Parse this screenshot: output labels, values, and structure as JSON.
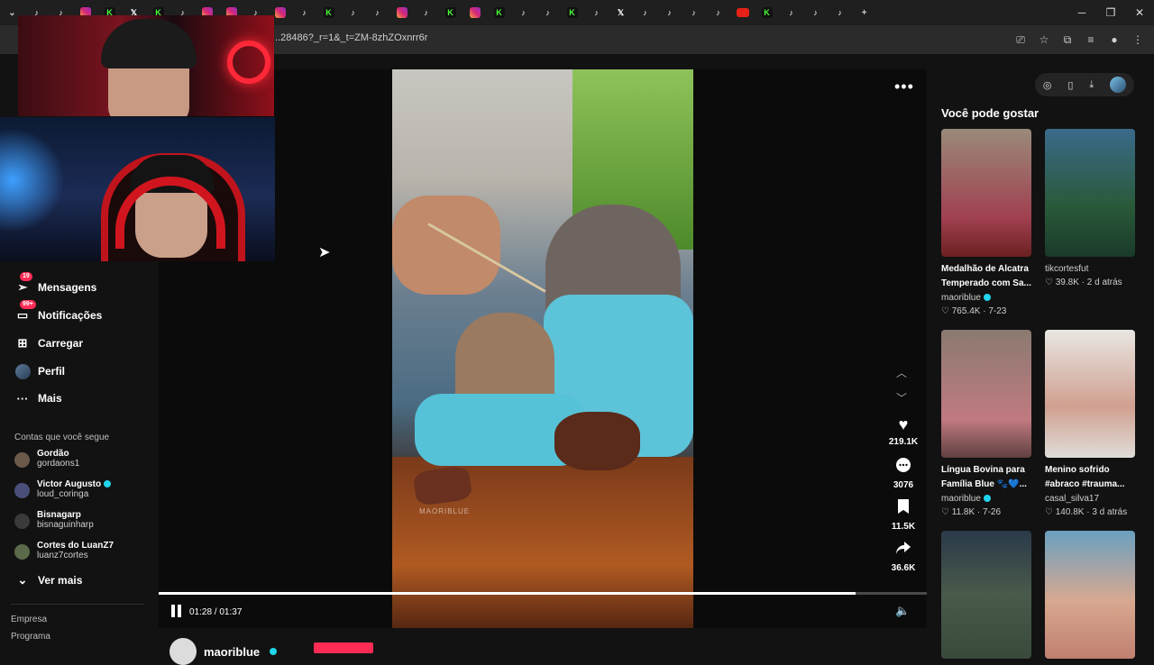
{
  "browser": {
    "url": "...28486?_r=1&_t=ZM-8zhZOxnrr6r",
    "tabs": [
      "tt",
      "tt",
      "ig",
      "k",
      "x",
      "k",
      "tt",
      "ig",
      "ig",
      "tt",
      "ig",
      "tt",
      "k",
      "tt",
      "tt",
      "ig",
      "tt",
      "k",
      "ig",
      "k",
      "tt",
      "tt",
      "k",
      "tt",
      "x",
      "tt",
      "tt",
      "tt",
      "tt",
      "yt",
      "k",
      "tt",
      "tt",
      "tt"
    ]
  },
  "sidebar": {
    "items": [
      {
        "label": "Mensagens",
        "icon": "send-icon",
        "badge": "19"
      },
      {
        "label": "Notificações",
        "icon": "inbox-icon",
        "badge": "99+"
      },
      {
        "label": "Carregar",
        "icon": "plus-square-icon"
      },
      {
        "label": "Perfil",
        "icon": "profile-avatar"
      },
      {
        "label": "Mais",
        "icon": "more-icon"
      }
    ],
    "following_title": "Contas que você segue",
    "following": [
      {
        "name": "Gordão",
        "handle": "gordaons1",
        "verified": false,
        "color": "#6b5a4a"
      },
      {
        "name": "Victor Augusto",
        "handle": "loud_coringa",
        "verified": true,
        "color": "#4a4f7a"
      },
      {
        "name": "Bisnagarp",
        "handle": "bisnaguinharp",
        "verified": false,
        "color": "#3a3a3a"
      },
      {
        "name": "Cortes do LuanZ7",
        "handle": "luanz7cortes",
        "verified": false,
        "color": "#5a6a4a"
      }
    ],
    "see_more": "Ver mais",
    "footer": [
      "Empresa",
      "Programa"
    ]
  },
  "player": {
    "watermark": "MAORIBLUE",
    "time": "01:28 / 01:37",
    "progress": 0.907,
    "author": "maoriblue",
    "actions": [
      {
        "icon": "heart-icon",
        "glyph": "♥",
        "count": "219.1K"
      },
      {
        "icon": "comment-icon",
        "glyph": "💬",
        "count": "3076"
      },
      {
        "icon": "bookmark-icon",
        "glyph": "🔖",
        "count": "11.5K"
      },
      {
        "icon": "share-icon",
        "glyph": "➦",
        "count": "36.6K"
      }
    ]
  },
  "recommend": {
    "title": "Você pode gostar",
    "cards": [
      {
        "title": "Medalhão de Alcatra Temperado com Sa...",
        "author": "maoriblue",
        "verified": true,
        "meta": "♡ 765.4K · 7-23",
        "bg": "linear-gradient(180deg,#9a8a7a,#a04050 70%,#6a2020)"
      },
      {
        "title": "",
        "author": "tikcortesfut",
        "verified": false,
        "meta": "♡ 39.8K · 2 d atrás",
        "bg": "linear-gradient(180deg,#3a6a8a,#2a5a3a 60%,#1a3a2a)"
      },
      {
        "title": "Língua Bovina para Família Blue 🐾💙...",
        "author": "maoriblue",
        "verified": true,
        "meta": "♡ 11.8K · 7-26",
        "bg": "linear-gradient(180deg,#8a7a70,#c07a80 70%,#604040)"
      },
      {
        "title": "Menino sofrido #abraco #trauma...",
        "author": "casal_silva17",
        "verified": false,
        "meta": "♡ 140.8K · 3 d atrás",
        "bg": "linear-gradient(180deg,#e8e6e2,#d0a090 60%,#e0ddd8)"
      },
      {
        "title": "",
        "author": "",
        "verified": false,
        "meta": "",
        "bg": "linear-gradient(180deg,#2a3a4a,#4a5a4a 50%,#3a4a3a)"
      },
      {
        "title": "",
        "author": "",
        "verified": false,
        "meta": "",
        "bg": "linear-gradient(180deg,#6aa0c0,#d8a890 55%,#c08070)"
      }
    ]
  }
}
